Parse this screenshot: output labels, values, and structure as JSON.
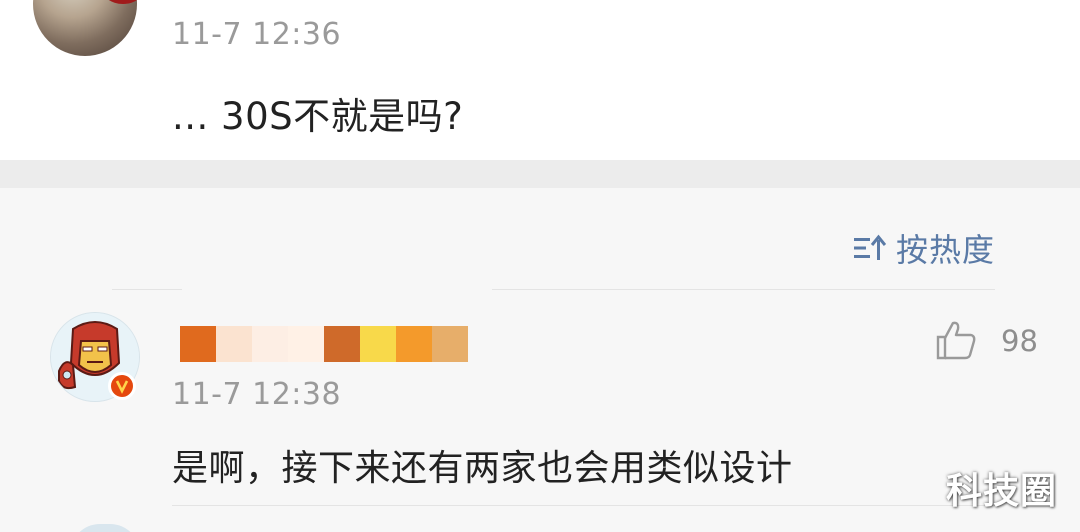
{
  "top_post": {
    "time": "11-7 12:36",
    "text": "... 30S不就是吗?"
  },
  "sort": {
    "icon": "sort-icon",
    "label": "按热度"
  },
  "comment": {
    "username_hidden": true,
    "verified_badge": "V",
    "time": "11-7 12:38",
    "text": "是啊，接下来还有两家也会用类似设计",
    "like_icon": "thumbs-up-icon",
    "like_count": "98"
  },
  "watermark": "科技圈",
  "colors": {
    "accent_blue": "#5a7aa6",
    "verified_orange": "#e5480e",
    "text_main": "#222222",
    "text_muted": "#9a9a9a"
  }
}
